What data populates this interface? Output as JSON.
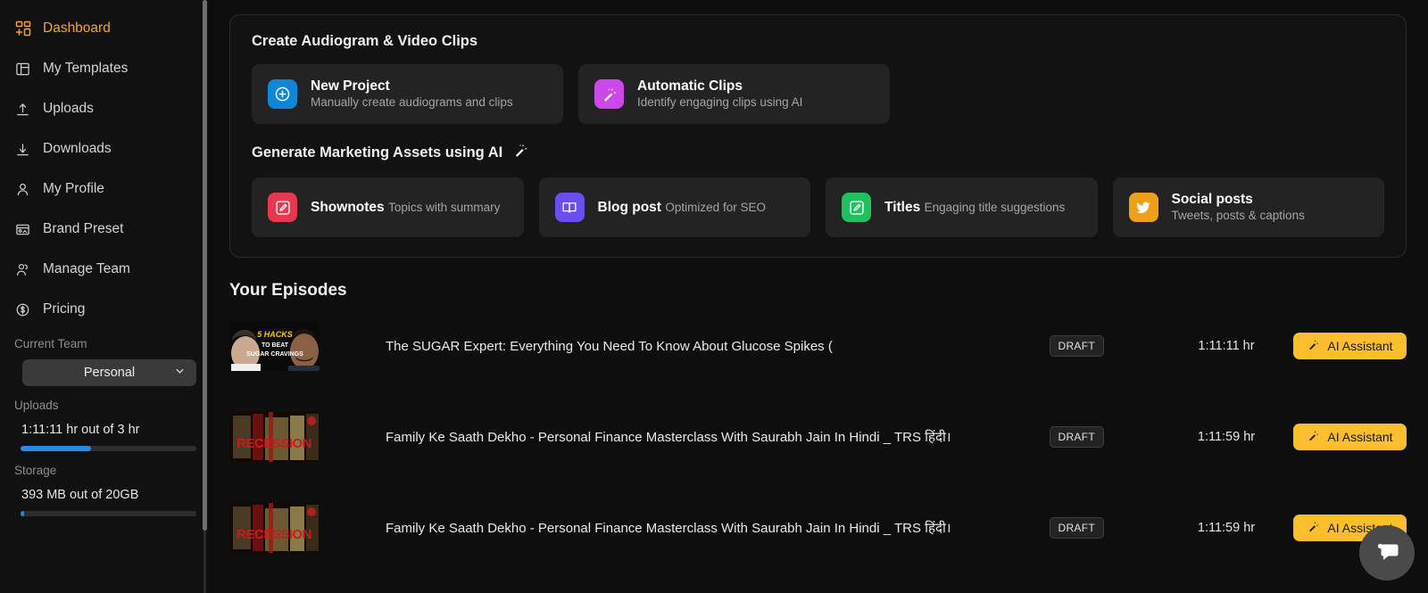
{
  "sidebar": {
    "items": [
      {
        "label": "Dashboard",
        "icon": "dashboard-icon",
        "active": true
      },
      {
        "label": "My Templates",
        "icon": "templates-icon",
        "active": false
      },
      {
        "label": "Uploads",
        "icon": "upload-icon",
        "active": false
      },
      {
        "label": "Downloads",
        "icon": "download-icon",
        "active": false
      },
      {
        "label": "My Profile",
        "icon": "user-icon",
        "active": false
      },
      {
        "label": "Brand Preset",
        "icon": "brand-icon",
        "active": false
      },
      {
        "label": "Manage Team",
        "icon": "team-icon",
        "active": false
      },
      {
        "label": "Pricing",
        "icon": "dollar-circle-icon",
        "active": false
      }
    ],
    "current_team_label": "Current Team",
    "team_value": "Personal",
    "uploads_label": "Uploads",
    "uploads_value": "1:11:11 hr out of 3 hr",
    "uploads_percent": 40,
    "storage_label": "Storage",
    "storage_value": "393 MB out of 20GB",
    "storage_percent": 2
  },
  "create_panel": {
    "title": "Create Audiogram & Video Clips",
    "cards": [
      {
        "title": "New Project",
        "subtitle": "Manually create audiograms and clips",
        "icon": "plus-circle-icon",
        "color": "#1186d6"
      },
      {
        "title": "Automatic Clips",
        "subtitle": "Identify engaging clips using AI",
        "icon": "magic-wand-icon",
        "color": "#cd48e8"
      }
    ],
    "assets_title": "Generate Marketing Assets using AI",
    "assets_title_icon": "magic-wand-icon",
    "assets": [
      {
        "title": "Shownotes",
        "subtitle": "Topics with summary",
        "icon": "edit-square-icon",
        "color": "#e8384f"
      },
      {
        "title": "Blog post",
        "subtitle": "Optimized for SEO",
        "icon": "book-icon",
        "color": "#6c4df0"
      },
      {
        "title": "Titles",
        "subtitle": "Engaging title suggestions",
        "icon": "edit-square-icon",
        "color": "#1fbf62"
      },
      {
        "title": "Social posts",
        "subtitle": "Tweets, posts & captions",
        "icon": "twitter-icon",
        "color": "#eda01a"
      }
    ]
  },
  "episodes": {
    "title": "Your Episodes",
    "rows": [
      {
        "title": "The SUGAR Expert: Everything You Need To Know About Glucose Spikes (",
        "status": "DRAFT",
        "duration": "1:11:11 hr",
        "action_label": "AI Assistant",
        "thumb": "sugar-cravings-thumbnail"
      },
      {
        "title": "Family Ke Saath Dekho - Personal Finance Masterclass With Saurabh Jain In Hindi _ TRS हिंदी।",
        "status": "DRAFT",
        "duration": "1:11:59 hr",
        "action_label": "AI Assistant",
        "thumb": "recession-thumbnail"
      },
      {
        "title": "Family Ke Saath Dekho - Personal Finance Masterclass With Saurabh Jain In Hindi _ TRS हिंदी।",
        "status": "DRAFT",
        "duration": "1:11:59 hr",
        "action_label": "AI Assistant",
        "thumb": "recession-thumbnail"
      }
    ]
  },
  "chat": {
    "icon": "chat-bubble-icon"
  },
  "colors": {
    "accent": "#f5a623",
    "button": "#fbbe2c",
    "progress": "#2a8ae0",
    "page_bg": "#0e0e0e",
    "sidebar_bg": "#111111"
  }
}
